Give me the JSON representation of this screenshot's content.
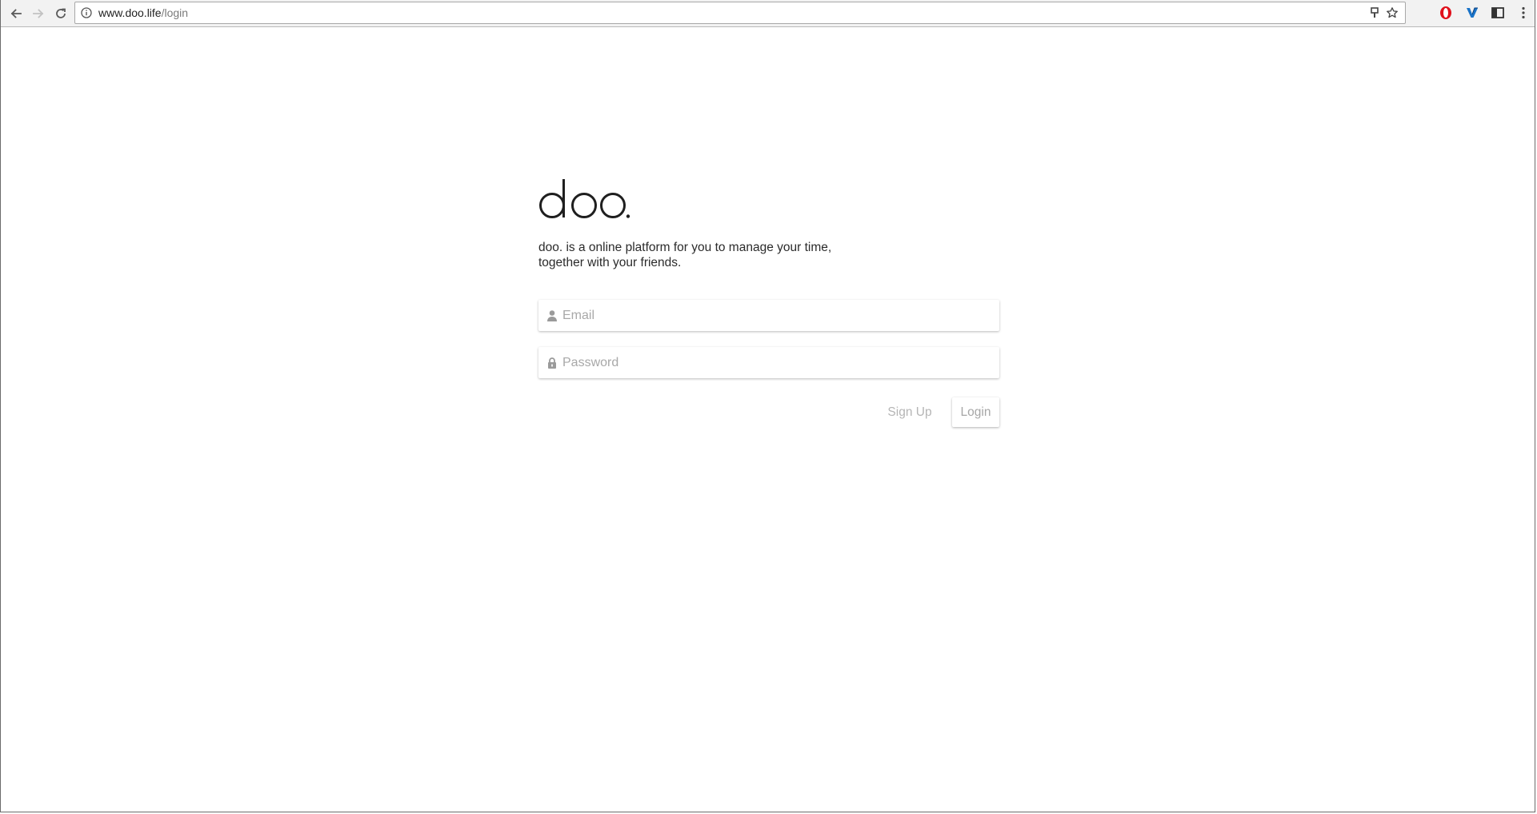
{
  "browser": {
    "url_host": "www.doo.life",
    "url_path": "/login",
    "icons": {
      "back": "arrow-left-icon",
      "forward": "arrow-right-icon",
      "reload": "reload-icon",
      "site_info": "info-icon",
      "key": "key-icon",
      "bookmark": "star-icon",
      "ext1": "opera-icon",
      "ext2": "v-extension-icon",
      "ext3": "panel-extension-icon",
      "menu": "kebab-menu-icon"
    }
  },
  "page": {
    "logo_text": "doo.",
    "tagline_line1": "doo. is a online platform for you to manage your time,",
    "tagline_line2": "together with your friends.",
    "email_placeholder": "Email",
    "password_placeholder": "Password",
    "signup_label": "Sign Up",
    "login_label": "Login"
  },
  "colors": {
    "text": "#2b2b2b",
    "placeholder": "#a8a8a8",
    "muted_button": "#b5b5b5",
    "opera_red": "#e0111c",
    "extension_blue": "#1a73c8"
  }
}
